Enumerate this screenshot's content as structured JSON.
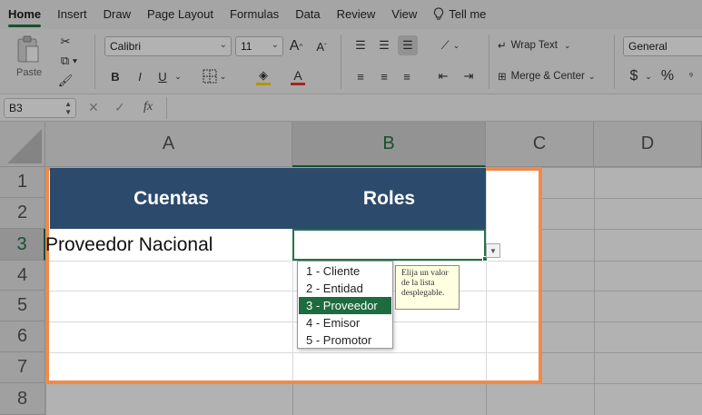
{
  "menu": {
    "tabs": [
      "Home",
      "Insert",
      "Draw",
      "Page Layout",
      "Formulas",
      "Data",
      "Review",
      "View"
    ],
    "active_tab": "Home",
    "tell_me": "Tell me"
  },
  "ribbon": {
    "paste_label": "Paste",
    "font_name": "Calibri",
    "font_size": "11",
    "grow_font": "A",
    "shrink_font": "A",
    "bold": "B",
    "italic": "I",
    "underline": "U",
    "wrap_text": "Wrap Text",
    "merge_center": "Merge & Center",
    "number_format": "General",
    "currency": "$",
    "percent": "%",
    "font_color_accent": "#e8363a",
    "fill_color_accent": "#ffd700"
  },
  "formula_bar": {
    "name_box": "B3",
    "fx": "fx",
    "content": ""
  },
  "grid": {
    "columns": [
      "A",
      "B",
      "C",
      "D"
    ],
    "rows": [
      "1",
      "2",
      "3",
      "4",
      "5",
      "6",
      "7",
      "8"
    ],
    "selected_column": "B",
    "selected_row": "3",
    "header_cells": [
      "Cuentas",
      "Roles"
    ],
    "cell_A3": "Proveedor Nacional",
    "cell_B3": ""
  },
  "dropdown": {
    "options": [
      "1 - Cliente",
      "2 - Entidad",
      "3 - Proveedor",
      "4 - Emisor",
      "5 - Promotor"
    ],
    "selected_index": 2
  },
  "tooltip": {
    "lines": [
      "Elija un valor",
      "de la lista",
      "desplegable."
    ]
  },
  "colors": {
    "header_fill": "#2c4a6b",
    "selection_green": "#217346",
    "highlight_border": "#f08a4b"
  }
}
